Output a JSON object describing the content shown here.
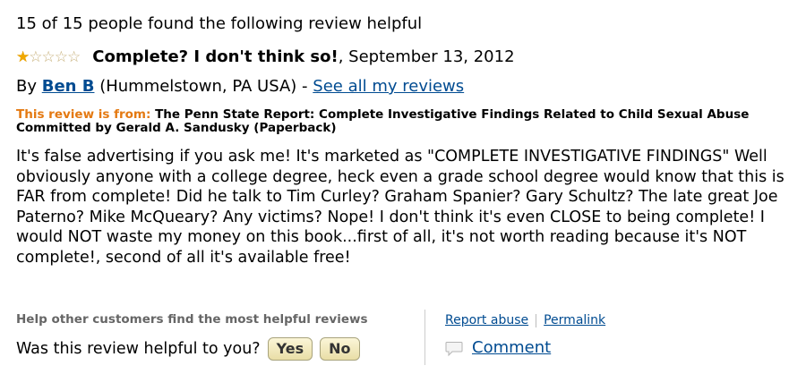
{
  "review": {
    "helpful_count_text": "15 of 15 people found the following review helpful",
    "rating": 1,
    "max_rating": 5,
    "title": "Complete? I don't think so!",
    "date_text": ", September 13, 2012",
    "by_label": "By ",
    "author": "Ben B",
    "location": " (Hummelstown, PA USA) - ",
    "see_all_link": "See all my reviews",
    "from_label": "This review is from:",
    "from_product": " The Penn State Report: Complete Investigative Findings Related to Child Sexual Abuse Committed by Gerald A. Sandusky (Paperback)",
    "body": "It's false advertising if you ask me! It's marketed as \"COMPLETE INVESTIGATIVE FINDINGS\" Well obviously anyone with a college degree, heck even a grade school degree would know that this is FAR from complete! Did he talk to Tim Curley? Graham Spanier? Gary Schultz? The late great Joe Paterno? Mike McQueary? Any victims? Nope! I don't think it's even CLOSE to being complete! I would NOT waste my money on this book...first of all, it's not worth reading because it's NOT complete!, second of all it's available free!"
  },
  "feedback": {
    "heading": "Help other customers find the most helpful reviews",
    "question": "Was this review helpful to you?",
    "yes_label": "Yes",
    "no_label": "No"
  },
  "actions": {
    "report_abuse": "Report abuse",
    "permalink": "Permalink",
    "comment": "Comment"
  },
  "icons": {
    "star_filled": "star-filled-icon",
    "star_empty": "star-empty-icon",
    "comment": "comment-bubble-icon"
  },
  "colors": {
    "link": "#004b91",
    "from_label": "#e47911",
    "star": "#f0a800"
  }
}
